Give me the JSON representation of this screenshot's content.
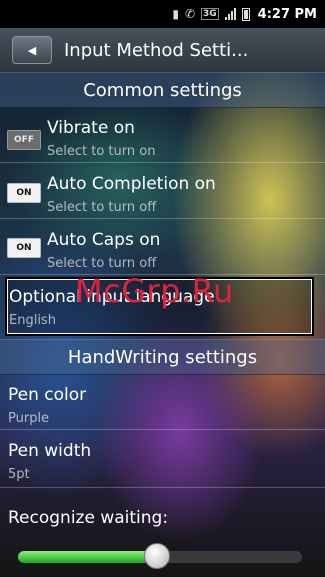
{
  "status_bar": {
    "icons": [
      "sim-icon",
      "phone-icon",
      "3g-icon",
      "signal-icon",
      "battery-icon"
    ],
    "network": "3G",
    "time": "4:27 PM"
  },
  "header": {
    "back_icon": "back-arrow-icon",
    "title": "Input Method Setti..."
  },
  "sections": {
    "common": "Common settings",
    "handwriting": "HandWriting settings"
  },
  "common_settings": [
    {
      "title": "Vibrate on",
      "subtitle": "Select to turn on",
      "toggle": "OFF"
    },
    {
      "title": "Auto Completion on",
      "subtitle": "Select to turn off",
      "toggle": "ON"
    },
    {
      "title": "Auto Caps on",
      "subtitle": "Select to turn off",
      "toggle": "ON"
    },
    {
      "title": "Optional input language",
      "subtitle": "English"
    }
  ],
  "handwriting_settings": [
    {
      "title": "Pen color",
      "subtitle": "Purple"
    },
    {
      "title": "Pen width",
      "subtitle": "5pt"
    },
    {
      "title": "Recognize waiting:"
    }
  ],
  "recognize_slider": {
    "level": 0.49
  },
  "watermark": "McGrp.Ru",
  "colors": {
    "slider_fill": "#1ea51e",
    "watermark": "#e3213a",
    "section_header": "#46648c"
  }
}
